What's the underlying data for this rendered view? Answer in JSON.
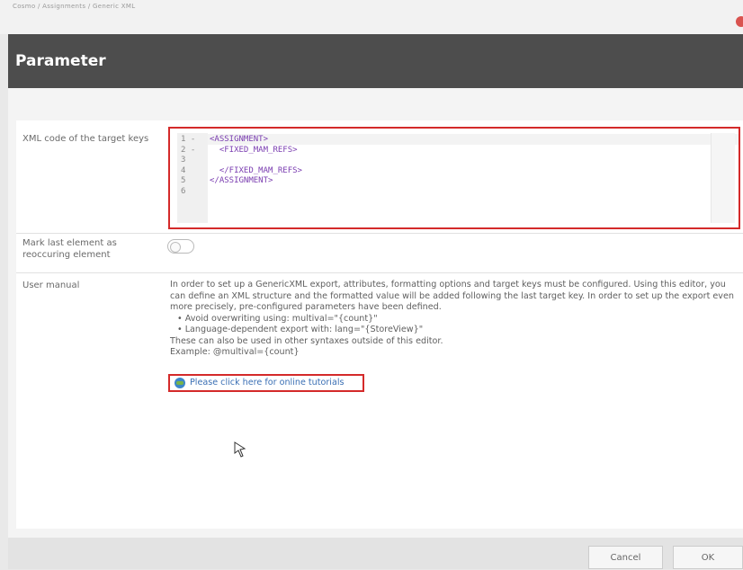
{
  "topbar": {
    "breadcrumb": "Cosmo / Assignments / Generic XML"
  },
  "dialog": {
    "title": "Parameter"
  },
  "fields": {
    "xml_label": "XML code of the target keys",
    "recurring_label": "Mark last element as reoccuring element",
    "manual_label": "User manual"
  },
  "editor": {
    "line_numbers": "1 -\n2 -\n3\n4\n5\n6",
    "code": "<ASSIGNMENT>\n  <FIXED_MAM_REFS>\n  \n  </FIXED_MAM_REFS>\n</ASSIGNMENT>\n"
  },
  "toggle": {
    "state": "off"
  },
  "manual": {
    "paragraph": "In order to set up a GenericXML export, attributes, formatting options and target keys must be configured. Using this editor, you can define an XML structure and the formatted value will be added following the last target key. In order to set up the export even more precisely, pre-configured parameters have been defined.",
    "bullet1": "•  Avoid overwriting using: multival=\"{count}\"",
    "bullet2": "•  Language-dependent export with: lang=\"{StoreView}\"",
    "after": "These can also be used in other syntaxes outside of this editor.",
    "example": "Example: @multival={count}",
    "link": "Please click here for online tutorials"
  },
  "footer": {
    "cancel": "Cancel",
    "ok": "OK"
  },
  "colors": {
    "header": "#4d4d4d",
    "highlight": "#d42a2a",
    "link": "#3a6fb4"
  }
}
